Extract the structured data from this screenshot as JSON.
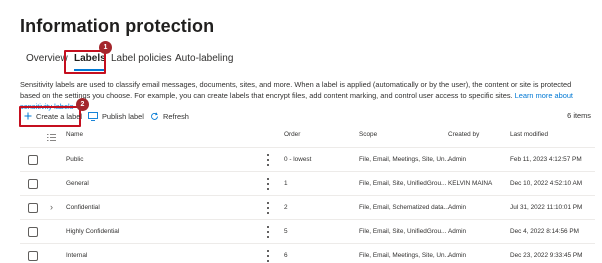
{
  "page_title": "Information protection",
  "tabs": [
    {
      "label": "Overview",
      "active": false
    },
    {
      "label": "Labels",
      "active": true
    },
    {
      "label": "Label policies",
      "active": false
    },
    {
      "label": "Auto-labeling",
      "active": false
    }
  ],
  "callouts": {
    "tab_badge": "1",
    "create_badge": "2",
    "color": "#c50f1f"
  },
  "description": {
    "text": "Sensitivity labels are used to classify email messages, documents, sites, and more. When a label is applied (automatically or by the user), the content or site is protected based on the settings you choose. For example, you can create labels that encrypt files, add content marking, and control user access to specific sites.",
    "link": "Learn more about sensitivity labels"
  },
  "toolbar": {
    "create_label": "Create a label",
    "publish_label": "Publish label",
    "refresh": "Refresh",
    "items_count": "6 items"
  },
  "table": {
    "columns": {
      "name": "Name",
      "order": "Order",
      "scope": "Scope",
      "created_by": "Created by",
      "last_modified": "Last modified"
    },
    "rows": [
      {
        "name": "Public",
        "order": "0 - lowest",
        "scope": "File, Email, Meetings, Site, Un...",
        "created_by": "Admin",
        "last_modified": "Feb 11, 2023 4:12:57 PM",
        "expandable": false
      },
      {
        "name": "General",
        "order": "1",
        "scope": "File, Email, Site, UnifiedGrou...",
        "created_by": "KELVIN MAINA",
        "last_modified": "Dec 10, 2022 4:52:10 AM",
        "expandable": false
      },
      {
        "name": "Confidential",
        "order": "2",
        "scope": "File, Email, Schematized data...",
        "created_by": "Admin",
        "last_modified": "Jul 31, 2022 11:10:01 PM",
        "expandable": true
      },
      {
        "name": "Highly Confidential",
        "order": "5",
        "scope": "File, Email, Site, UnifiedGrou...",
        "created_by": "Admin",
        "last_modified": "Dec 4, 2022 8:14:56 PM",
        "expandable": false
      },
      {
        "name": "Internal",
        "order": "6",
        "scope": "File, Email, Meetings, Site, Un...",
        "created_by": "Admin",
        "last_modified": "Dec 23, 2022 9:33:45 PM",
        "expandable": false
      }
    ]
  },
  "colors": {
    "accent": "#0078d4",
    "callout": "#c50f1f",
    "badge": "#a4262c"
  },
  "icons": {
    "create": "plus-icon",
    "publish": "publish-icon",
    "refresh": "refresh-icon",
    "list": "list-icon",
    "more": "more-vertical-icon",
    "expand": "chevron-right-icon"
  }
}
